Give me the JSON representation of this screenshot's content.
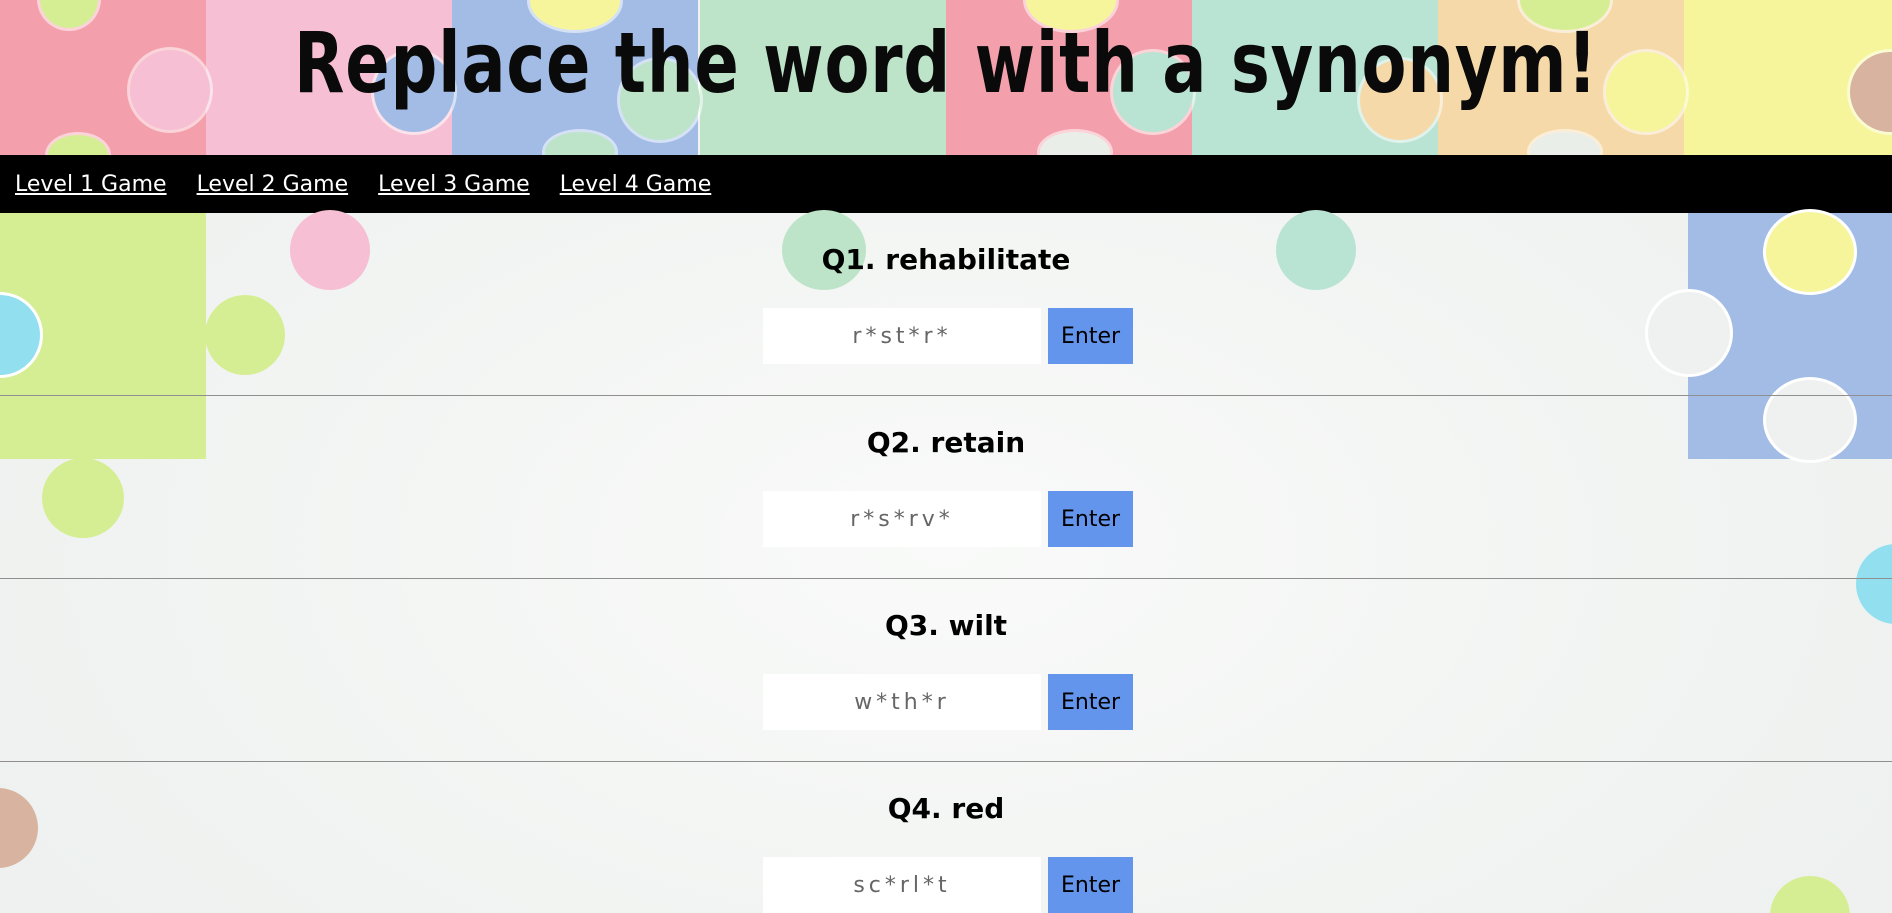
{
  "header": {
    "title": "Replace the word with a synonym!"
  },
  "nav": {
    "items": [
      {
        "label": "Level 1 Game"
      },
      {
        "label": "Level 2 Game"
      },
      {
        "label": "Level 3 Game"
      },
      {
        "label": "Level 4 Game"
      }
    ]
  },
  "questions": [
    {
      "title": "Q1. rehabilitate",
      "placeholder": "r*st*r*",
      "button": "Enter"
    },
    {
      "title": "Q2. retain",
      "placeholder": "r*s*rv*",
      "button": "Enter"
    },
    {
      "title": "Q3. wilt",
      "placeholder": "w*th*r",
      "button": "Enter"
    },
    {
      "title": "Q4. red",
      "placeholder": "sc*rl*t",
      "button": "Enter"
    }
  ],
  "colors": {
    "nav_background": "#000000",
    "nav_link": "#ffffff",
    "button": "#6495ed",
    "puzzle_pink": "#f4a0ac",
    "puzzle_light_pink": "#f6bfd3",
    "puzzle_blue": "#a2bce6",
    "puzzle_green": "#bde4c8",
    "puzzle_yellow": "#f6f59c",
    "puzzle_mint": "#b9e3d3",
    "puzzle_peach": "#f6d9a8",
    "puzzle_lime": "#d6ee93"
  }
}
